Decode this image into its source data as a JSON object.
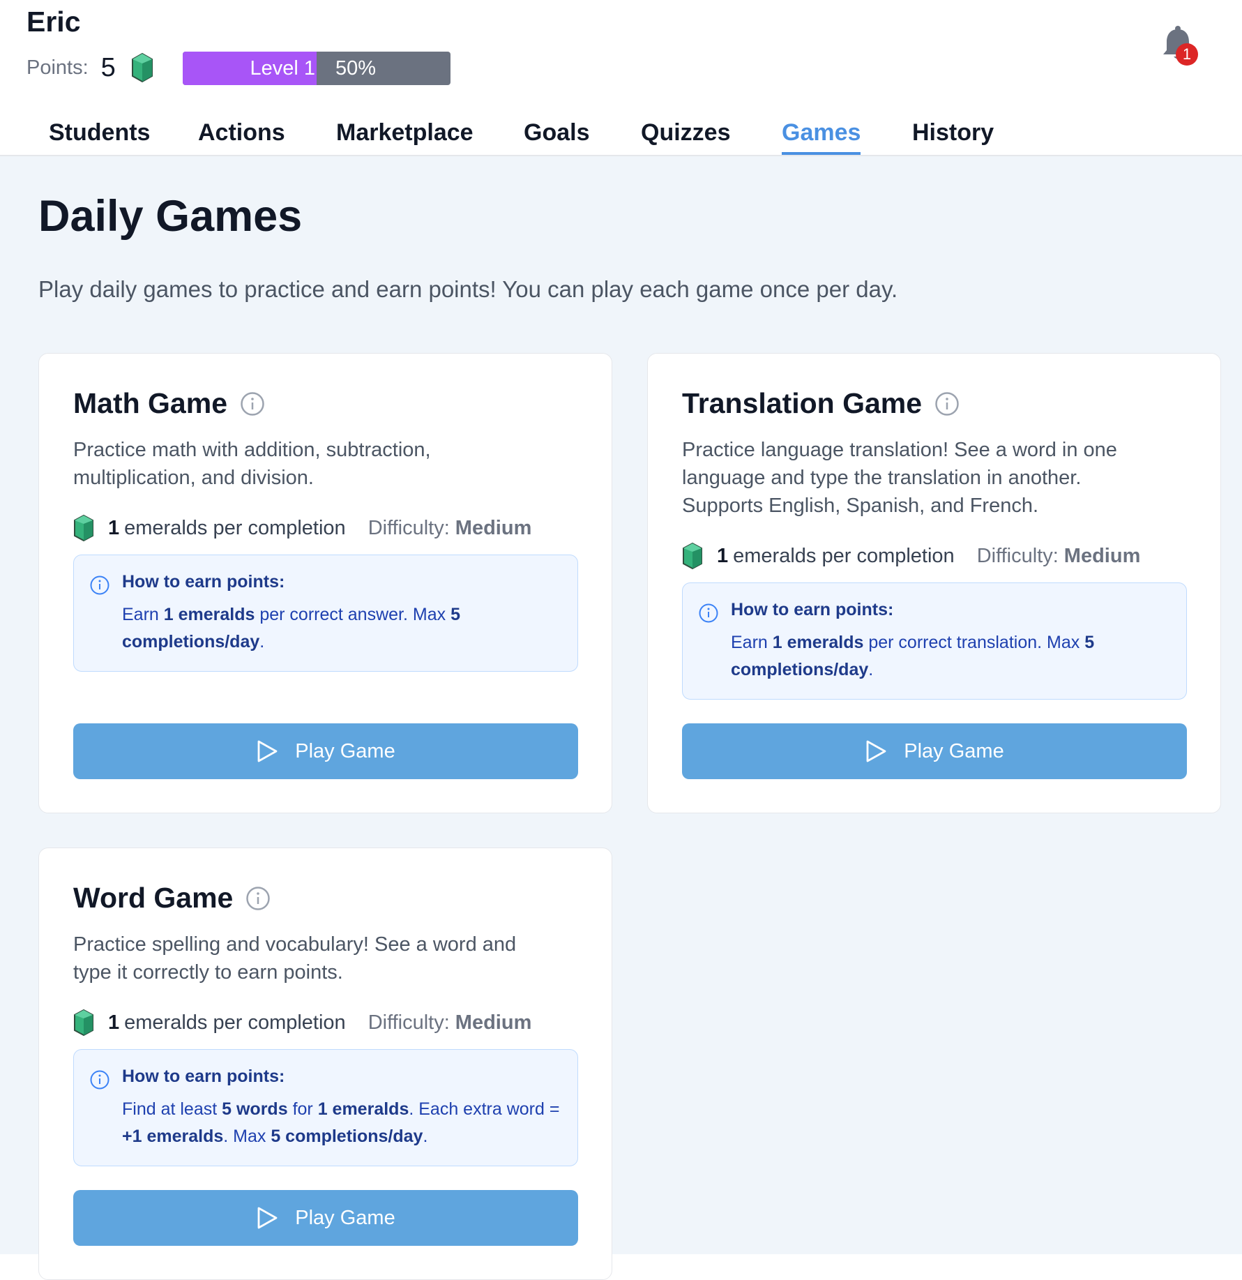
{
  "header": {
    "user_name": "Eric",
    "points_label": "Points:",
    "points_value": "5",
    "gem_icon": "emerald-icon",
    "level_label": "Level 1",
    "level_percent_text": "50%",
    "level_progress": 0.5,
    "notification_count": "1"
  },
  "nav": {
    "tabs": [
      {
        "label": "Students"
      },
      {
        "label": "Actions"
      },
      {
        "label": "Marketplace"
      },
      {
        "label": "Goals"
      },
      {
        "label": "Quizzes"
      },
      {
        "label": "Games",
        "active": true
      },
      {
        "label": "History"
      }
    ]
  },
  "page": {
    "title": "Daily Games",
    "description": "Play daily games to practice and earn points! You can play each game once per day."
  },
  "games": [
    {
      "title": "Math Game",
      "description": "Practice math with addition, subtraction, multiplication, and division.",
      "reward_num": "1",
      "reward_text": "emeralds per completion",
      "difficulty_label": "Difficulty:",
      "difficulty_value": "Medium",
      "earn_title": "How to earn points:",
      "earn_parts": [
        "Earn ",
        "1 emeralds",
        " per correct answer. Max ",
        "5 completions/day",
        "."
      ],
      "play_label": "Play Game"
    },
    {
      "title": "Translation Game",
      "description": "Practice language translation! See a word in one language and type the translation in another. Supports English, Spanish, and French.",
      "reward_num": "1",
      "reward_text": "emeralds per completion",
      "difficulty_label": "Difficulty:",
      "difficulty_value": "Medium",
      "earn_title": "How to earn points:",
      "earn_parts": [
        "Earn ",
        "1 emeralds",
        " per correct translation. Max ",
        "5 completions/day",
        "."
      ],
      "play_label": "Play Game"
    },
    {
      "title": "Word Game",
      "description": "Practice spelling and vocabulary! See a word and type it correctly to earn points.",
      "reward_num": "1",
      "reward_text": "emeralds per completion",
      "difficulty_label": "Difficulty:",
      "difficulty_value": "Medium",
      "earn_title": "How to earn points:",
      "earn_parts": [
        "Find at least ",
        "5 words",
        " for ",
        "1 emeralds",
        ". Each extra word = ",
        "+1 emeralds",
        ". Max ",
        "5 completions/day",
        "."
      ],
      "play_label": "Play Game"
    }
  ],
  "colors": {
    "accent": "#4a90e2",
    "level_fill": "#a855f7",
    "level_track": "#6b7280",
    "play_button": "#5fa5de",
    "info_box_bg": "#f0f6ff",
    "badge": "#dc2626",
    "emerald": "#34b27b"
  }
}
